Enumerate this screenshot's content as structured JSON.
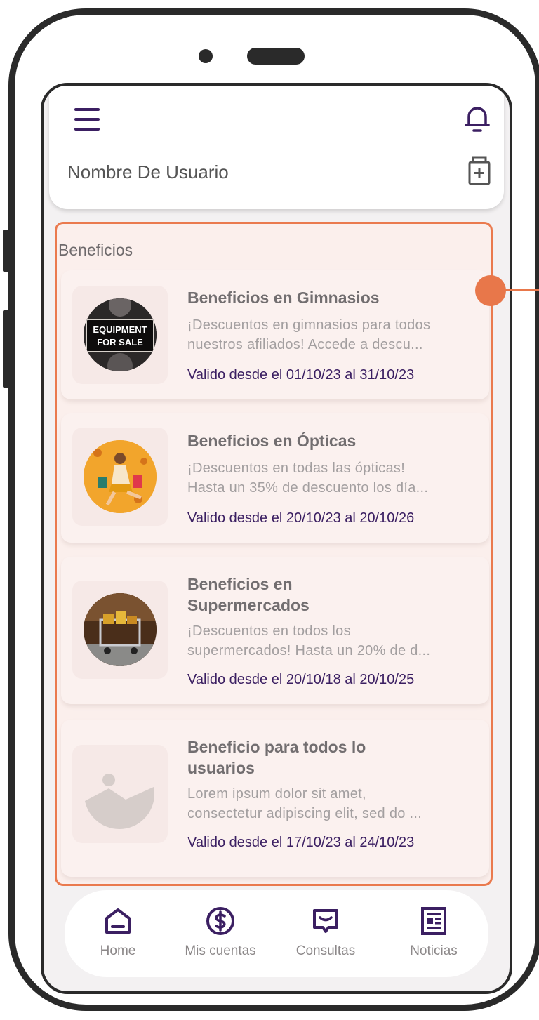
{
  "header": {
    "username": "Nombre De Usuario"
  },
  "benefits": {
    "section_title": "Beneficios",
    "items": [
      {
        "title": "Beneficios en Gimnasios",
        "description_line1": "¡Descuentos en gimnasios para todos",
        "description_line2": "nuestros afiliados! Accede a descu...",
        "validity": "Valido desde el 01/10/23 al 31/10/23",
        "image_text_line1": "EQUIPMENT",
        "image_text_line2": "FOR SALE"
      },
      {
        "title": "Beneficios en Ópticas",
        "description_line1": "¡Descuentos en todas las ópticas!",
        "description_line2": "Hasta un 35% de descuento los día...",
        "validity": "Valido desde el 20/10/23 al 20/10/26"
      },
      {
        "title_line1": "Beneficios en",
        "title_line2": "Supermercados",
        "description_line1": "¡Descuentos en todos los",
        "description_line2": "supermercados! Hasta un 20% de d...",
        "validity": "Valido desde el 20/10/18 al 20/10/25"
      },
      {
        "title_line1": "Beneficio para todos lo",
        "title_line2": "usuarios",
        "description_line1": "Lorem ipsum dolor sit amet,",
        "description_line2": "consectetur adipiscing elit, sed do ...",
        "validity": "Valido desde el 17/10/23 al 24/10/23"
      }
    ]
  },
  "nav": {
    "items": [
      {
        "label": "Home",
        "icon": "home-icon"
      },
      {
        "label": "Mis cuentas",
        "icon": "dollar-icon"
      },
      {
        "label": "Consultas",
        "icon": "chat-icon"
      },
      {
        "label": "Noticias",
        "icon": "newspaper-icon"
      }
    ]
  },
  "colors": {
    "accent": "#3b1f62",
    "highlight": "#e8774a",
    "panel_bg": "#fbefec"
  }
}
